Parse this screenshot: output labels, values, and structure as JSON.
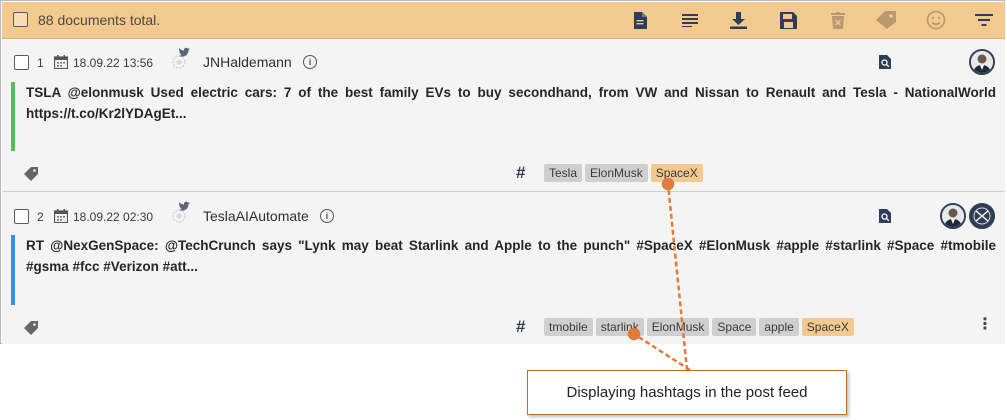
{
  "toolbar": {
    "total_text": "88 documents total.",
    "icons": [
      "document-icon",
      "list-icon",
      "download-icon",
      "save-icon",
      "delete-icon",
      "tag-icon",
      "sentiment-icon",
      "filter-icon"
    ]
  },
  "posts": [
    {
      "index": "1",
      "date": "18.09.22 13:56",
      "author": "JNHaldemann",
      "text": "TSLA @elonmusk Used electric cars: 7 of the best family EVs to buy secondhand, from VW and Nissan to Renault and Tesla - NationalWorld https://t.co/Kr2lYDAgEt...",
      "hashtags": [
        "Tesla",
        "ElonMusk",
        "SpaceX"
      ],
      "highlighted": "SpaceX",
      "accent_color": "#5cb85c"
    },
    {
      "index": "2",
      "date": "18.09.22 02:30",
      "author": "TeslaAIAutomate",
      "text": "RT @NexGenSpace: @TechCrunch says \"Lynk may beat Starlink and Apple to the punch\" #SpaceX #ElonMusk #apple #starlink #Space #tmobile #gsma #fcc #Verizon #att...",
      "hashtags": [
        "tmobile",
        "starlink",
        "ElonMusk",
        "Space",
        "apple",
        "SpaceX"
      ],
      "highlighted": "SpaceX",
      "accent_color": "#3b8fe0"
    }
  ],
  "hash_symbol": "#",
  "callout": {
    "text": "Displaying hashtags in the post feed"
  },
  "colors": {
    "toolbar_bg": "#f2c98f",
    "chip_bg": "#cfcfcf",
    "chip_highlight": "#f2c98f",
    "callout_border": "#b5722f",
    "arrow": "#e07b39"
  }
}
